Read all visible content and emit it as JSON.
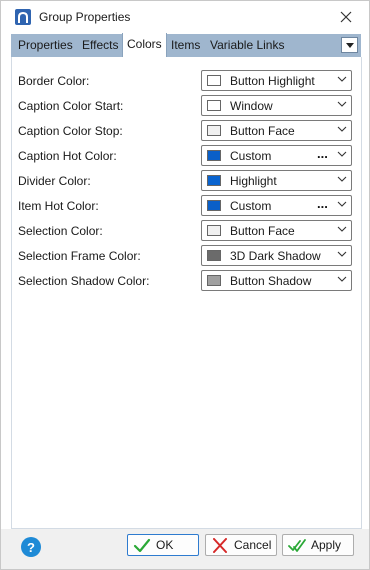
{
  "window": {
    "title": "Group Properties"
  },
  "tabs": [
    {
      "label": "Properties",
      "active": false
    },
    {
      "label": "Effects",
      "active": false
    },
    {
      "label": "Colors",
      "active": true
    },
    {
      "label": "Items",
      "active": false
    },
    {
      "label": "Variable Links",
      "active": false
    }
  ],
  "rows": [
    {
      "label": "Border Color:",
      "value": "Button Highlight",
      "swatch": "#ffffff",
      "ellipsis": ""
    },
    {
      "label": "Caption Color Start:",
      "value": "Window",
      "swatch": "#ffffff",
      "ellipsis": ""
    },
    {
      "label": "Caption Color Stop:",
      "value": "Button Face",
      "swatch": "#f0f0f0",
      "ellipsis": ""
    },
    {
      "label": "Caption Hot Color:",
      "value": "Custom",
      "swatch": "#0a5fc8",
      "ellipsis": "..."
    },
    {
      "label": "Divider Color:",
      "value": "Highlight",
      "swatch": "#0a64d0",
      "ellipsis": ""
    },
    {
      "label": "Item Hot Color:",
      "value": "Custom",
      "swatch": "#0a5fc8",
      "ellipsis": "..."
    },
    {
      "label": "Selection Color:",
      "value": "Button Face",
      "swatch": "#f0f0f0",
      "ellipsis": ""
    },
    {
      "label": "Selection Frame Color:",
      "value": "3D Dark Shadow",
      "swatch": "#6b6b6b",
      "ellipsis": ""
    },
    {
      "label": "Selection Shadow Color:",
      "value": "Button Shadow",
      "swatch": "#a0a0a0",
      "ellipsis": ""
    }
  ],
  "footer": {
    "help": "?",
    "ok_label": "OK",
    "cancel_label": "Cancel",
    "apply_label": "Apply"
  },
  "colors": {
    "tabstrip": "#9fb6ce",
    "accent": "#1e8ad6",
    "ok_check": "#2aa836",
    "cancel_x": "#d62828"
  }
}
